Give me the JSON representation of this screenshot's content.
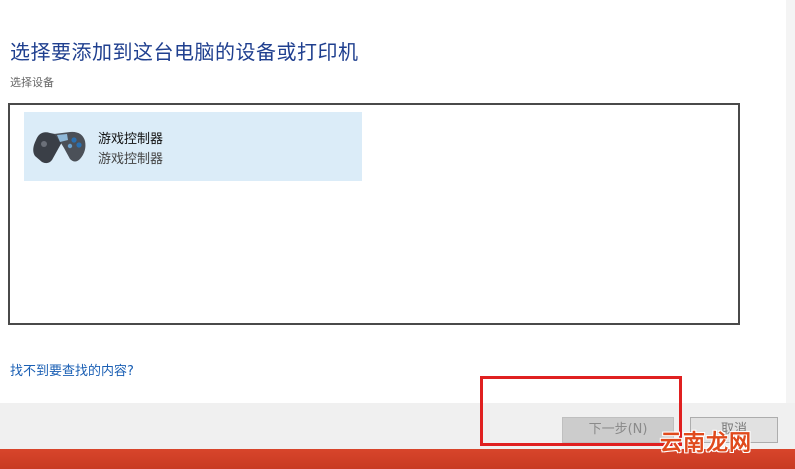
{
  "header": {
    "title": "选择要添加到这台电脑的设备或打印机",
    "subtitle": "选择设备"
  },
  "devices": [
    {
      "name": "游戏控制器",
      "type": "游戏控制器",
      "icon": "gamepad-icon"
    }
  ],
  "help_link": "找不到要查找的内容?",
  "footer": {
    "next_label": "下一步(N)",
    "cancel_label": "取消"
  },
  "watermark": "云南龙网",
  "colors": {
    "title": "#1f3f8f",
    "selection": "#dbecf8",
    "annotation": "#e02020",
    "bottom_bar": "#d8452b"
  }
}
